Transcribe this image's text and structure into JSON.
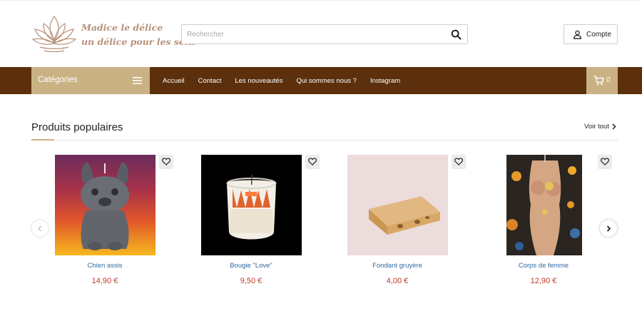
{
  "brand": {
    "line1": "Madice le délice",
    "line2": "un délice pour les sens",
    "color": "#b8927a"
  },
  "search": {
    "placeholder": "Rechercher",
    "icon": "search-icon"
  },
  "account": {
    "label": "Compte",
    "icon": "user-icon"
  },
  "navbar": {
    "background": "#5c300c",
    "accent": "#c9b183",
    "categories_label": "Catégories",
    "links": [
      "Accueil",
      "Contact",
      "Les nouveautés",
      "Qui sommes nous ?",
      "Instagram"
    ],
    "cart_count": "0"
  },
  "section": {
    "title": "Produits populaires",
    "see_all": "Voir tout"
  },
  "products": [
    {
      "name": "Chien assis",
      "price": "14,90 €"
    },
    {
      "name": "Bougie \"Love\"",
      "price": "9,50 €"
    },
    {
      "name": "Fondant gruyère",
      "price": "4,00 €"
    },
    {
      "name": "Corps de femme",
      "price": "12,90 €"
    }
  ],
  "colors": {
    "price": "#c0392b",
    "product_link": "#2f6aa6"
  }
}
